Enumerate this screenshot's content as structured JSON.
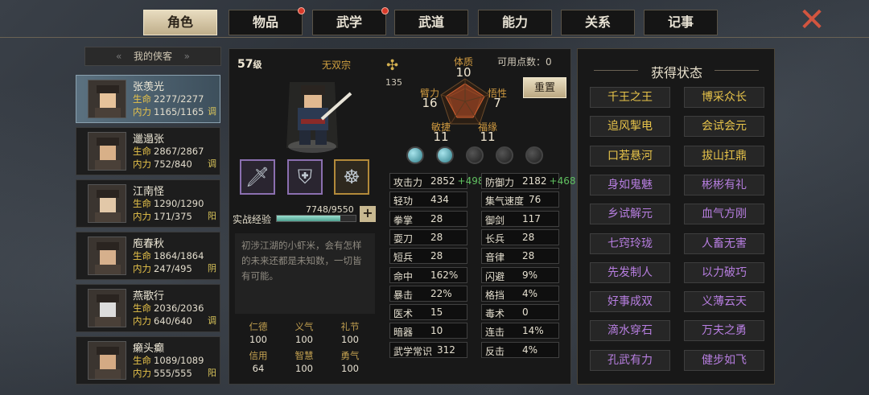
{
  "tabs": [
    {
      "label": "角色",
      "active": true,
      "dot": false
    },
    {
      "label": "物品",
      "active": false,
      "dot": true
    },
    {
      "label": "武学",
      "active": false,
      "dot": true
    },
    {
      "label": "武道",
      "active": false,
      "dot": false
    },
    {
      "label": "能力",
      "active": false,
      "dot": false
    },
    {
      "label": "关系",
      "active": false,
      "dot": false
    },
    {
      "label": "记事",
      "active": false,
      "dot": false
    }
  ],
  "close_icon": "close-x-icon",
  "list_header": "我的侠客",
  "heroes": [
    {
      "name": "张羡光",
      "hp": "2277/2277",
      "mp": "1165/1165",
      "tag": "调",
      "selected": true
    },
    {
      "name": "邋遢张",
      "hp": "2867/2867",
      "mp": "752/840",
      "tag": "调",
      "selected": false
    },
    {
      "name": "江南怪",
      "hp": "1290/1290",
      "mp": "171/375",
      "tag": "阳",
      "selected": false
    },
    {
      "name": "庖春秋",
      "hp": "1864/1864",
      "mp": "247/495",
      "tag": "阴",
      "selected": false
    },
    {
      "name": "燕歌行",
      "hp": "2036/2036",
      "mp": "640/640",
      "tag": "调",
      "selected": false
    },
    {
      "name": "癞头癫",
      "hp": "1089/1089",
      "mp": "555/555",
      "tag": "阳",
      "selected": false
    }
  ],
  "labels": {
    "hp": "生命",
    "mp": "内力"
  },
  "char": {
    "level": "57",
    "level_unit": "级",
    "sect": "无双宗",
    "power": "135",
    "exp_label": "实战经验",
    "exp_value": "7748/9550",
    "exp_fraction": 0.811,
    "desc": "初涉江湖的小虾米，会有怎样的未来还都是未知数，一切皆有可能。",
    "virtues": [
      {
        "k": "仁德",
        "v": "100"
      },
      {
        "k": "义气",
        "v": "100"
      },
      {
        "k": "礼节",
        "v": "100"
      },
      {
        "k": "信用",
        "v": "64"
      },
      {
        "k": "智慧",
        "v": "100"
      },
      {
        "k": "勇气",
        "v": "100"
      }
    ]
  },
  "stats": {
    "avail": "可用点数：0",
    "reset": "重置",
    "tizhi": {
      "k": "体质",
      "v": "10"
    },
    "bili": {
      "k": "臂力",
      "v": "16"
    },
    "wuxing": {
      "k": "悟性",
      "v": "7"
    },
    "minjie": {
      "k": "敏捷",
      "v": "11"
    },
    "fuyuan": {
      "k": "福缘",
      "v": "11"
    }
  },
  "orbs": [
    true,
    true,
    false,
    false,
    false
  ],
  "attrs_left": [
    {
      "k": "攻击力",
      "v": "2852",
      "b": "+498"
    },
    {
      "k": "轻功",
      "v": "434"
    },
    {
      "k": "拳掌",
      "v": "28"
    },
    {
      "k": "耍刀",
      "v": "28"
    },
    {
      "k": "短兵",
      "v": "28"
    },
    {
      "k": "命中",
      "v": "162%"
    },
    {
      "k": "暴击",
      "v": "22%"
    },
    {
      "k": "医术",
      "v": "15"
    },
    {
      "k": "暗器",
      "v": "10"
    },
    {
      "k": "武学常识",
      "v": "312"
    }
  ],
  "attrs_right": [
    {
      "k": "防御力",
      "v": "2182",
      "b": "+468"
    },
    {
      "k": "集气速度",
      "v": "76"
    },
    {
      "k": "御剑",
      "v": "117"
    },
    {
      "k": "长兵",
      "v": "28"
    },
    {
      "k": "音律",
      "v": "28"
    },
    {
      "k": "闪避",
      "v": "9%"
    },
    {
      "k": "格挡",
      "v": "4%"
    },
    {
      "k": "毒术",
      "v": "0"
    },
    {
      "k": "连击",
      "v": "14%"
    },
    {
      "k": "反击",
      "v": "4%"
    }
  ],
  "status_title": "获得状态",
  "status": [
    {
      "t": "千王之王",
      "c": "y"
    },
    {
      "t": "博采众长",
      "c": "y"
    },
    {
      "t": "追风掣电",
      "c": "y"
    },
    {
      "t": "会试会元",
      "c": "y"
    },
    {
      "t": "口若悬河",
      "c": "y"
    },
    {
      "t": "拔山扛鼎",
      "c": "y"
    },
    {
      "t": "身如鬼魅",
      "c": "p"
    },
    {
      "t": "彬彬有礼",
      "c": "p"
    },
    {
      "t": "乡试解元",
      "c": "p"
    },
    {
      "t": "血气方刚",
      "c": "p"
    },
    {
      "t": "七窍玲珑",
      "c": "p"
    },
    {
      "t": "人畜无害",
      "c": "p"
    },
    {
      "t": "先发制人",
      "c": "p"
    },
    {
      "t": "以力破巧",
      "c": "p"
    },
    {
      "t": "好事成双",
      "c": "p"
    },
    {
      "t": "义薄云天",
      "c": "p"
    },
    {
      "t": "滴水穿石",
      "c": "p"
    },
    {
      "t": "万夫之勇",
      "c": "p"
    },
    {
      "t": "孔武有力",
      "c": "p"
    },
    {
      "t": "健步如飞",
      "c": "p"
    }
  ]
}
